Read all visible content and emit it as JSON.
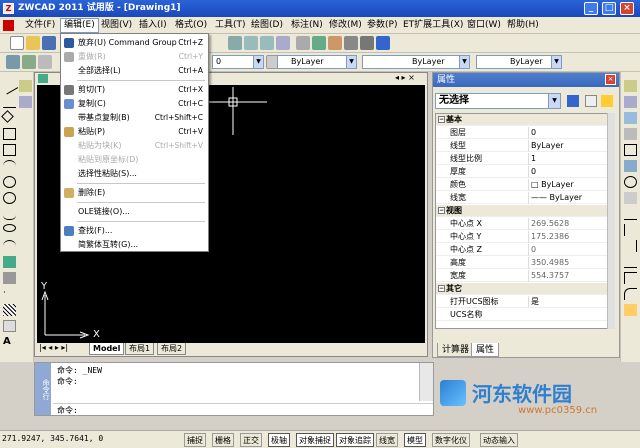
{
  "window": {
    "title": "ZWCAD 2011 试用版 - [Drawing1]",
    "controls": [
      "_",
      "□",
      "×"
    ]
  },
  "menubar": {
    "items": [
      "文件(F)",
      "编辑(E)",
      "视图(V)",
      "插入(I)",
      "格式(O)",
      "工具(T)",
      "绘图(D)",
      "标注(N)",
      "修改(M)",
      "参数(P)",
      "ET扩展工具(X)",
      "窗口(W)",
      "帮助(H)"
    ],
    "active_index": 1
  },
  "toolbar2": {
    "layer_value": "0",
    "color_value": "ByLayer",
    "linetype_value": "ByLayer",
    "lineweight_value": "ByLayer"
  },
  "edit_menu": {
    "items": [
      {
        "label": "放弃(U) Command Group",
        "shortcut": "Ctrl+Z",
        "disabled": false,
        "icon": "undo-icon"
      },
      {
        "label": "重做(R)",
        "shortcut": "Ctrl+Y",
        "disabled": true,
        "icon": "redo-icon"
      },
      {
        "label": "全部选择(L)",
        "shortcut": "Ctrl+A",
        "disabled": false,
        "icon": ""
      },
      {
        "label": "剪切(T)",
        "shortcut": "Ctrl+X",
        "disabled": false,
        "icon": "cut-icon"
      },
      {
        "label": "复制(C)",
        "shortcut": "Ctrl+C",
        "disabled": false,
        "icon": "copy-icon"
      },
      {
        "label": "带基点复制(B)",
        "shortcut": "Ctrl+Shift+C",
        "disabled": false,
        "icon": ""
      },
      {
        "label": "粘贴(P)",
        "shortcut": "Ctrl+V",
        "disabled": false,
        "icon": "paste-icon"
      },
      {
        "label": "粘贴为块(K)",
        "shortcut": "Ctrl+Shift+V",
        "disabled": true,
        "icon": ""
      },
      {
        "label": "粘贴到原坐标(D)",
        "shortcut": "",
        "disabled": true,
        "icon": ""
      },
      {
        "label": "选择性粘贴(S)...",
        "shortcut": "",
        "disabled": false,
        "icon": ""
      },
      {
        "label": "删除(E)",
        "shortcut": "",
        "disabled": false,
        "icon": "erase-icon"
      },
      {
        "label": "OLE链接(O)...",
        "shortcut": "",
        "disabled": false,
        "icon": ""
      },
      {
        "label": "查找(F)...",
        "shortcut": "",
        "disabled": false,
        "icon": "find-icon"
      },
      {
        "label": "简繁体互转(G)...",
        "shortcut": "",
        "disabled": false,
        "icon": ""
      }
    ]
  },
  "drawing": {
    "ucs_y": "Y",
    "ucs_x": "X",
    "tabs": [
      "Model",
      "布局1",
      "布局2"
    ],
    "active_tab": 0
  },
  "properties": {
    "title": "属性",
    "selection": "无选择",
    "rows": [
      {
        "cat": true,
        "key": "基本"
      },
      {
        "key": "图层",
        "value": "0"
      },
      {
        "key": "线型",
        "value": "ByLayer"
      },
      {
        "key": "线型比例",
        "value": "1"
      },
      {
        "key": "厚度",
        "value": "0"
      },
      {
        "key": "颜色",
        "value": "□ ByLayer"
      },
      {
        "key": "线宽",
        "value": "—— ByLayer"
      },
      {
        "cat": true,
        "key": "视图"
      },
      {
        "key": "中心点 X",
        "value": "269.5628",
        "gray": true
      },
      {
        "key": "中心点 Y",
        "value": "175.2386",
        "gray": true
      },
      {
        "key": "中心点 Z",
        "value": "0",
        "gray": true
      },
      {
        "key": "高度",
        "value": "350.4985",
        "gray": true
      },
      {
        "key": "宽度",
        "value": "554.3757",
        "gray": true
      },
      {
        "cat": true,
        "key": "其它"
      },
      {
        "key": "打开UCS图标",
        "value": "是"
      },
      {
        "key": "UCS名称",
        "value": ""
      }
    ],
    "tabs": [
      "计算器",
      "属性"
    ],
    "active_tab": 1
  },
  "command": {
    "panel_label": "命令行",
    "lines": [
      "命令: _NEW",
      "命令:"
    ],
    "prompt": "命令:"
  },
  "watermark": {
    "text": "河东软件园",
    "url": "www.pc0359.cn"
  },
  "statusbar": {
    "coords": "271.9247,  345.7641,  0",
    "toggles": [
      {
        "label": "捕捉",
        "on": false
      },
      {
        "label": "栅格",
        "on": false
      },
      {
        "label": "正交",
        "on": false
      },
      {
        "label": "极轴",
        "on": true
      },
      {
        "label": "对象捕捉",
        "on": true
      },
      {
        "label": "对象追踪",
        "on": true
      },
      {
        "label": "线宽",
        "on": false
      },
      {
        "label": "模型",
        "on": true
      },
      {
        "label": "数字化仪",
        "on": false
      },
      {
        "label": "动态输入",
        "on": false
      }
    ]
  },
  "colors": {
    "titlebar": "#1b48b8",
    "canvas": "#000000",
    "menu_highlight": "#c7d7f2"
  }
}
